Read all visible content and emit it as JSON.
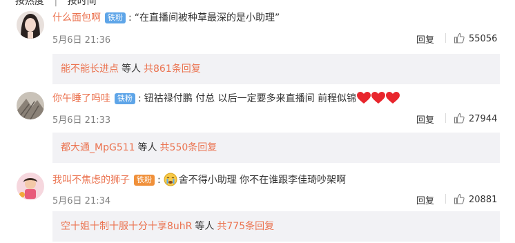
{
  "topbar": {
    "left": "按热度",
    "right": "按时间"
  },
  "comments": [
    {
      "user": "什么面包啊",
      "badge": "铁粉",
      "text": "“在直播间被种草最深的是小助理”",
      "time": "5月6日 21:36",
      "reply_label": "回复",
      "likes": "55056",
      "reply_preview": {
        "name": "能不能长进点",
        "mid": "等人",
        "count": "共861条回复"
      }
    },
    {
      "user": "你午睡了吗哇",
      "badge": "铁粉",
      "text": "钮祜禄付鹏 付总 以后一定要多来直播间 前程似锦",
      "hearts": 3,
      "time": "5月6日 21:33",
      "reply_label": "回复",
      "likes": "27944",
      "reply_preview": {
        "name": "都大通_MpG511",
        "mid": "等人",
        "count": "共550条回复"
      }
    },
    {
      "user": "我叫不焦虑的狮子",
      "badge": "铁粉",
      "text": "舍不得小助理 你不在谁跟李佳琦吵架啊",
      "time": "5月6日 21:34",
      "reply_label": "回复",
      "likes": "20881",
      "reply_preview": {
        "name": "空十姐十制十服十分十享8uhR",
        "mid": "等人",
        "count": "共775条回复"
      }
    }
  ],
  "colors": {
    "username": "#eb7350",
    "badge": "#5ea5e8",
    "reply_bg": "#f2f2f5",
    "meta": "#808080"
  }
}
